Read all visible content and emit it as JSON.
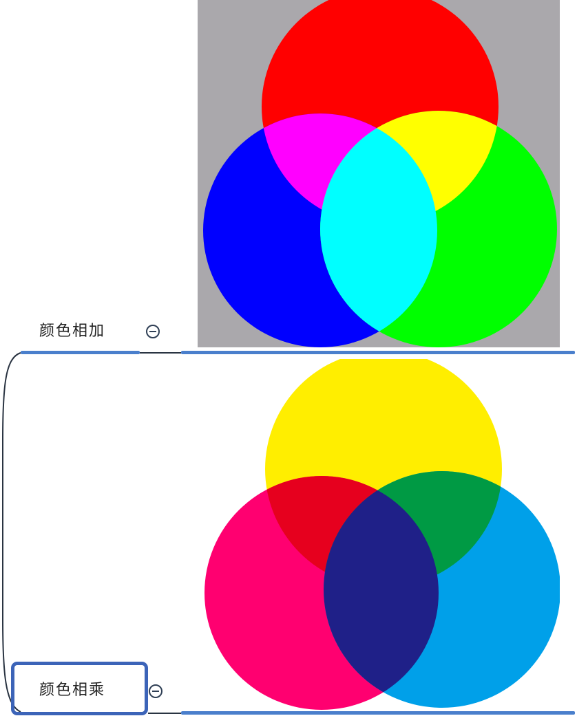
{
  "mindmap": {
    "topics": [
      {
        "label": "颜色相加",
        "image": "additive-rgb-color-circles"
      },
      {
        "label": "颜色相乘",
        "image": "subtractive-cmy-color-circles"
      }
    ],
    "icons": {
      "collapse": "collapse-minus-icon"
    },
    "colors": {
      "line_blue": "#4a7fcc",
      "selection_blue": "#3c64b8",
      "branch_curve": "#2a3442",
      "additive_background": "#aaa8ac",
      "red": "#ff0000",
      "green": "#00ff00",
      "blue": "#0000ff",
      "yellow": "#ffee00",
      "magenta": "#ff0070",
      "cyan": "#00a0e9"
    }
  }
}
